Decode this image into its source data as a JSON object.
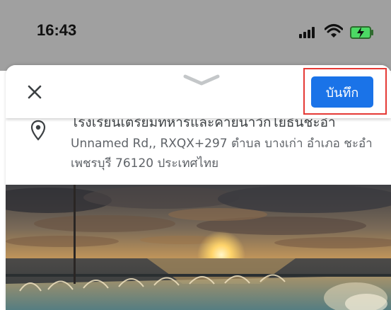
{
  "status_bar": {
    "time": "16:43",
    "icons": [
      "cellular-signal-icon",
      "wifi-icon",
      "battery-charging-icon"
    ]
  },
  "sheet": {
    "close_icon": "close-icon",
    "drag_handle_icon": "chevron-down-icon",
    "save_label": "บันทึก",
    "place_title": "โรงเรียนเตรียมทหารและค่ายนาวิกโยธินชะอำ",
    "address": "Unnamed Rd,, RXQX+297 ตำบล บางเก่า อำเภอ ชะอำ เพชรบุรี 76120 ประเทศไทย",
    "location_icon": "location-pin-icon",
    "photo_label": "sunset-photo"
  },
  "colors": {
    "accent": "#1a73e8",
    "highlight": "#e53935",
    "text_secondary": "#5f6368",
    "battery": "#4cd964"
  }
}
